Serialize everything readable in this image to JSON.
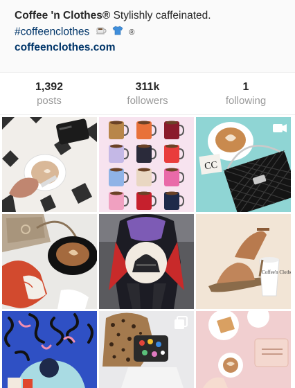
{
  "profile": {
    "name": "Coffee 'n Clothes®",
    "tagline": "Stylishly caffeinated.",
    "hashtag": "#coffeenclothes",
    "registered": "®",
    "website": "coffeenclothes.com"
  },
  "stats": [
    {
      "value": "1,392",
      "label": "posts"
    },
    {
      "value": "311k",
      "label": "followers"
    },
    {
      "value": "1",
      "label": "following"
    }
  ],
  "posts": [
    {
      "name": "post-latte-clutch-tiles"
    },
    {
      "name": "post-colorful-mugs-grid"
    },
    {
      "name": "post-chanel-quilted-bag-latte",
      "badge": "video-icon"
    },
    {
      "name": "post-gucci-bag-coffee-cup"
    },
    {
      "name": "post-street-style-bag"
    },
    {
      "name": "post-sandal-cup"
    },
    {
      "name": "post-squiggle-illustration"
    },
    {
      "name": "post-leopard-coat-pins",
      "badge": "multi-photo-icon"
    },
    {
      "name": "post-pink-table-coffee"
    }
  ],
  "mug_text": "Coffee'n Clothes",
  "colors": {
    "link": "#003569",
    "muted": "#999999",
    "text": "#262626"
  }
}
